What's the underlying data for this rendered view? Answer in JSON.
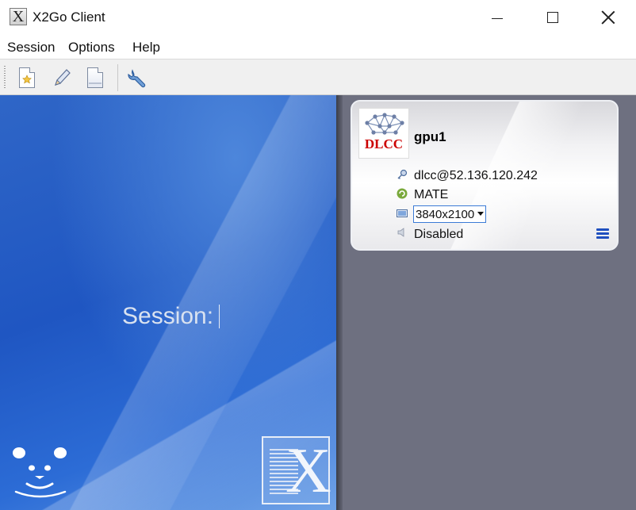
{
  "window": {
    "title": "X2Go Client",
    "icon": "x2go-app-icon"
  },
  "menu": {
    "items": [
      "Session",
      "Options",
      "Help"
    ]
  },
  "toolbar": {
    "buttons": [
      "new-session-icon",
      "edit-session-icon",
      "delete-session-icon",
      "preferences-wrench-icon"
    ]
  },
  "login": {
    "session_label": "Session:",
    "session_value": ""
  },
  "session_card": {
    "name": "gpu1",
    "avatar_text": "DLCC",
    "host": "dlcc@52.136.120.242",
    "desktop": "MATE",
    "resolution": "3840x2100",
    "sound": "Disabled"
  },
  "colors": {
    "left_panel": "#2560c8",
    "right_panel": "#6e7080",
    "accent": "#1f4fbf",
    "avatar_text": "#cc0000"
  }
}
